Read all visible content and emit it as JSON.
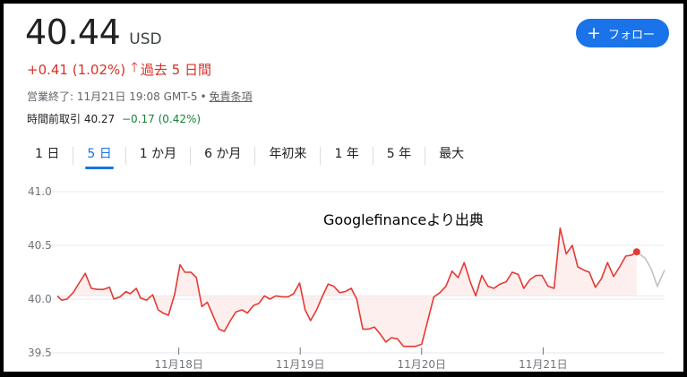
{
  "header": {
    "price": "40.44",
    "currency": "USD",
    "change": "+0.41 (1.02%)",
    "change_arrow": "🡑",
    "change_period": "過去 5 日間",
    "market_status": "営業終了: 11月21日 19:08 GMT-5",
    "bullet": "•",
    "disclaimer": "免責条項",
    "premarket_label": "時間前取引 40.27",
    "premarket_change": "−0.17 (0.42%)"
  },
  "follow_button": {
    "icon": "plus-icon",
    "label": "フォロー"
  },
  "tabs": [
    {
      "label": "1 日",
      "active": false
    },
    {
      "label": "5 日",
      "active": true
    },
    {
      "label": "1 か月",
      "active": false
    },
    {
      "label": "6 か月",
      "active": false
    },
    {
      "label": "年初来",
      "active": false
    },
    {
      "label": "1 年",
      "active": false
    },
    {
      "label": "5 年",
      "active": false
    },
    {
      "label": "最大",
      "active": false
    }
  ],
  "watermark": "Googlefinanceより出典",
  "colors": {
    "line": "#e53935",
    "fill": "#fce8e6",
    "extension": "#bdc1c6",
    "accent": "#1a73e8",
    "negative": "#d93025",
    "positive": "#188038"
  },
  "chart_data": {
    "type": "line",
    "ylim": [
      39.5,
      41.0
    ],
    "yticks": [
      "41.0",
      "40.5",
      "40.0",
      "39.5"
    ],
    "ytick_values": [
      41.0,
      40.5,
      40.0,
      39.5
    ],
    "xlim": [
      0,
      100
    ],
    "xticks": [
      {
        "label": "11月18日",
        "x": 20
      },
      {
        "label": "11月19日",
        "x": 40
      },
      {
        "label": "11月20日",
        "x": 60
      },
      {
        "label": "11月21日",
        "x": 80
      }
    ],
    "baseline": 40.03,
    "series": [
      {
        "values": [
          [
            0.0,
            40.03
          ],
          [
            0.7,
            39.99
          ],
          [
            1.6,
            40.0
          ],
          [
            2.6,
            40.06
          ],
          [
            3.6,
            40.15
          ],
          [
            4.6,
            40.24
          ],
          [
            5.6,
            40.1
          ],
          [
            6.6,
            40.09
          ],
          [
            7.6,
            40.09
          ],
          [
            8.6,
            40.11
          ],
          [
            9.3,
            40.0
          ],
          [
            10.3,
            40.02
          ],
          [
            11.3,
            40.07
          ],
          [
            12.0,
            40.05
          ],
          [
            13.0,
            40.1
          ],
          [
            13.7,
            40.01
          ],
          [
            14.7,
            39.99
          ],
          [
            15.7,
            40.04
          ],
          [
            16.6,
            39.9
          ],
          [
            17.4,
            39.87
          ],
          [
            18.3,
            39.85
          ],
          [
            19.3,
            40.04
          ],
          [
            20.2,
            40.32
          ],
          [
            21.0,
            40.25
          ],
          [
            22.0,
            40.25
          ],
          [
            22.9,
            40.2
          ],
          [
            23.8,
            39.93
          ],
          [
            24.7,
            39.97
          ],
          [
            26.6,
            39.72
          ],
          [
            27.5,
            39.7
          ],
          [
            28.5,
            39.8
          ],
          [
            29.4,
            39.88
          ],
          [
            30.4,
            39.9
          ],
          [
            31.3,
            39.87
          ],
          [
            32.3,
            39.94
          ],
          [
            33.2,
            39.96
          ],
          [
            34.1,
            40.03
          ],
          [
            35.0,
            40.0
          ],
          [
            36.0,
            40.03
          ],
          [
            37.0,
            40.02
          ],
          [
            38.0,
            40.02
          ],
          [
            38.9,
            40.05
          ],
          [
            39.9,
            40.15
          ],
          [
            40.8,
            39.9
          ],
          [
            41.7,
            39.8
          ],
          [
            42.7,
            39.9
          ],
          [
            43.6,
            40.02
          ],
          [
            44.6,
            40.14
          ],
          [
            45.5,
            40.12
          ],
          [
            46.5,
            40.06
          ],
          [
            47.4,
            40.07
          ],
          [
            48.4,
            40.1
          ],
          [
            49.3,
            40.0
          ],
          [
            50.3,
            39.72
          ],
          [
            51.2,
            39.72
          ],
          [
            52.2,
            39.74
          ],
          [
            53.1,
            39.68
          ],
          [
            54.1,
            39.6
          ],
          [
            55.0,
            39.64
          ],
          [
            56.0,
            39.63
          ],
          [
            57.0,
            39.56
          ],
          [
            58.0,
            39.56
          ],
          [
            59.0,
            39.56
          ],
          [
            60.0,
            39.58
          ],
          [
            61.0,
            39.8
          ],
          [
            62.0,
            40.02
          ],
          [
            63.0,
            40.06
          ],
          [
            64.0,
            40.12
          ],
          [
            65.0,
            40.26
          ],
          [
            66.0,
            40.2
          ],
          [
            67.0,
            40.34
          ],
          [
            68.0,
            40.16
          ],
          [
            68.9,
            40.03
          ],
          [
            69.9,
            40.22
          ],
          [
            70.9,
            40.12
          ],
          [
            71.9,
            40.1
          ],
          [
            72.9,
            40.14
          ],
          [
            73.9,
            40.16
          ],
          [
            74.9,
            40.25
          ],
          [
            75.9,
            40.23
          ],
          [
            76.8,
            40.1
          ],
          [
            77.8,
            40.18
          ],
          [
            78.8,
            40.22
          ],
          [
            79.8,
            40.22
          ],
          [
            80.8,
            40.12
          ],
          [
            81.8,
            40.1
          ],
          [
            82.8,
            40.66
          ],
          [
            83.8,
            40.42
          ],
          [
            84.8,
            40.5
          ],
          [
            85.7,
            40.3
          ],
          [
            86.7,
            40.27
          ],
          [
            87.6,
            40.25
          ],
          [
            88.6,
            40.11
          ],
          [
            89.6,
            40.19
          ],
          [
            90.6,
            40.34
          ],
          [
            91.6,
            40.21
          ],
          [
            92.6,
            40.3
          ],
          [
            93.6,
            40.4
          ],
          [
            94.6,
            40.41
          ],
          [
            95.4,
            40.44
          ]
        ]
      },
      {
        "values": [
          [
            95.4,
            40.44
          ],
          [
            96.8,
            40.38
          ],
          [
            97.8,
            40.28
          ],
          [
            98.8,
            40.12
          ],
          [
            100.0,
            40.27
          ]
        ]
      }
    ],
    "last_point": [
      95.4,
      40.44
    ]
  }
}
